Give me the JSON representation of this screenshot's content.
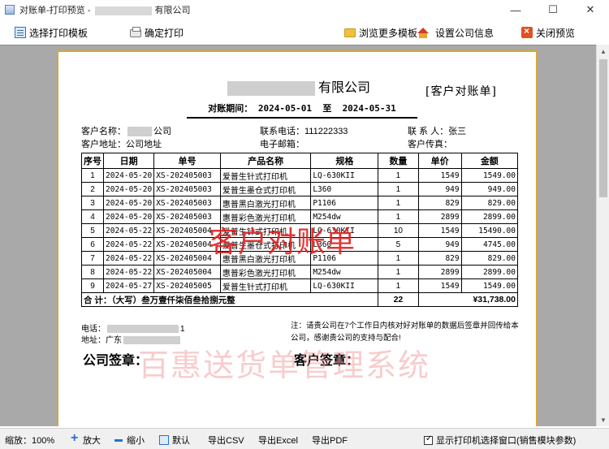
{
  "window": {
    "title_prefix": "对账单-打印预览 - ",
    "title_suffix": "有限公司",
    "minimize": "—",
    "maximize": "☐",
    "close": "✕"
  },
  "toolbar": {
    "select_template": "选择打印模板",
    "confirm_print": "确定打印",
    "browse_templates": "浏览更多模板",
    "company_settings": "设置公司信息",
    "close_preview": "关闭预览"
  },
  "document": {
    "company_name": "有限公司",
    "doc_type": "[客户对账单]",
    "period_label": "对账期间：",
    "period_start": "2024-05-01",
    "period_to": "至",
    "period_end": "2024-05-31",
    "customer_name_label": "客户名称：",
    "customer_name_suffix": "公司",
    "phone_label": "联系电话：",
    "phone": "111222333",
    "contact_label": "联 系 人：",
    "contact": "张三",
    "address_label": "客户地址：",
    "address": "公司地址",
    "email_label": "电子邮箱：",
    "email": "",
    "fax_label": "客户传真：",
    "fax": "",
    "columns": [
      "序号",
      "日期",
      "单号",
      "产品名称",
      "规格",
      "数量",
      "单价",
      "金额"
    ],
    "rows": [
      {
        "no": "1",
        "date": "2024-05-20",
        "code": "XS-202405003",
        "name": "爱普生针式打印机",
        "spec": "LQ-630KII",
        "qty": "1",
        "price": "1549",
        "amount": "1549.00"
      },
      {
        "no": "2",
        "date": "2024-05-20",
        "code": "XS-202405003",
        "name": "爱普生墨仓式打印机",
        "spec": "L360",
        "qty": "1",
        "price": "949",
        "amount": "949.00"
      },
      {
        "no": "3",
        "date": "2024-05-20",
        "code": "XS-202405003",
        "name": "惠普黑白激光打印机",
        "spec": "P1106",
        "qty": "1",
        "price": "829",
        "amount": "829.00"
      },
      {
        "no": "4",
        "date": "2024-05-20",
        "code": "XS-202405003",
        "name": "惠普彩色激光打印机",
        "spec": "M254dw",
        "qty": "1",
        "price": "2899",
        "amount": "2899.00"
      },
      {
        "no": "5",
        "date": "2024-05-22",
        "code": "XS-202405004",
        "name": "爱普生针式打印机",
        "spec": "LQ-630KII",
        "qty": "10",
        "price": "1549",
        "amount": "15490.00"
      },
      {
        "no": "6",
        "date": "2024-05-22",
        "code": "XS-202405004",
        "name": "爱普生墨仓式打印机",
        "spec": "L360",
        "qty": "5",
        "price": "949",
        "amount": "4745.00"
      },
      {
        "no": "7",
        "date": "2024-05-22",
        "code": "XS-202405004",
        "name": "惠普黑白激光打印机",
        "spec": "P1106",
        "qty": "1",
        "price": "829",
        "amount": "829.00"
      },
      {
        "no": "8",
        "date": "2024-05-22",
        "code": "XS-202405004",
        "name": "惠普彩色激光打印机",
        "spec": "M254dw",
        "qty": "1",
        "price": "2899",
        "amount": "2899.00"
      },
      {
        "no": "9",
        "date": "2024-05-27",
        "code": "XS-202405005",
        "name": "爱普生针式打印机",
        "spec": "LQ-630KII",
        "qty": "1",
        "price": "1549",
        "amount": "1549.00"
      }
    ],
    "total_label": "合 计：（大写）叁万壹仟柒佰叁拾捌元整",
    "total_qty": "22",
    "total_amount": "¥31,738.00",
    "phone2_label": "电话：",
    "phone2_suffix": "1",
    "address2_label": "地址：广东",
    "note": "注：请贵公司在7个工作日内核对好对账单的数据后签章并回传给本公司，感谢贵公司的支持与配合!",
    "company_sign": "公司签章：",
    "customer_sign": "客户签章：",
    "stamp_text": "客户对账单",
    "watermark_text": "百惠送货单管理系统"
  },
  "statusbar": {
    "zoom_label": "缩放：100%",
    "zoom_in": "放大",
    "zoom_out": "缩小",
    "default": "默认",
    "export_csv": "导出CSV",
    "export_excel": "导出Excel",
    "export_pdf": "导出PDF",
    "show_printer_dialog": "显示打印机选择窗口(销售模块参数)"
  }
}
